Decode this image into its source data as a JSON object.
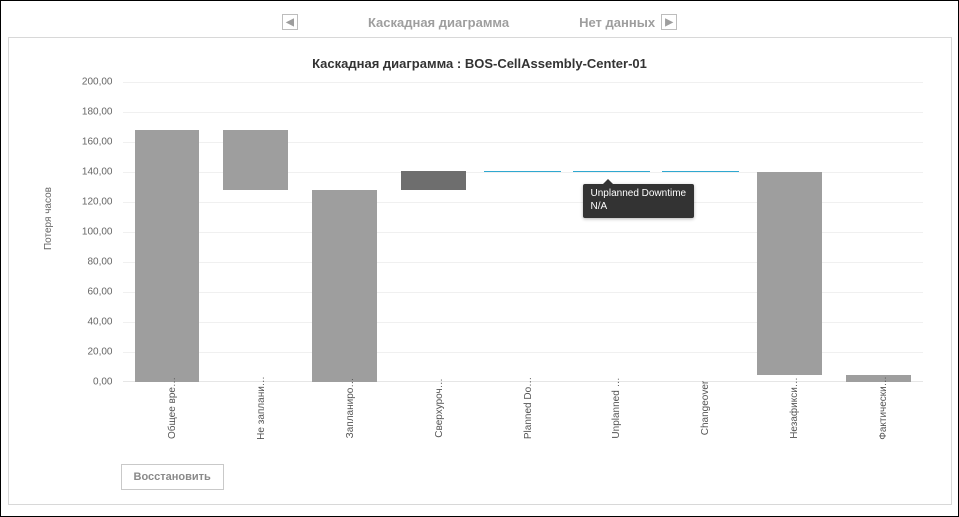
{
  "nav": {
    "center_label": "Каскадная диаграмма",
    "right_label": "Нет данных"
  },
  "chart": {
    "title": "Каскадная диаграмма : BOS-CellAssembly-Center-01",
    "ylabel": "Потеря часов",
    "reset_label": "Восстановить"
  },
  "tooltip": {
    "line1": "Unplanned Downtime",
    "line2": "N/A"
  },
  "yticks": [
    "0,00",
    "20,00",
    "40,00",
    "60,00",
    "80,00",
    "100,00",
    "120,00",
    "140,00",
    "160,00",
    "180,00",
    "200,00"
  ],
  "xcats": [
    "Общее вре…",
    "Не заплани…",
    "Запланиро…",
    "Сверхуроч…",
    "Planned Do…",
    "Unplanned …",
    "Changeover",
    "Незафикси…",
    "Фактически…"
  ],
  "chart_data": {
    "type": "bar",
    "title": "Каскадная диаграмма : BOS-CellAssembly-Center-01",
    "ylabel": "Потеря часов",
    "xlabel": "",
    "ylim": [
      0,
      200
    ],
    "categories": [
      "Общее вре…",
      "Не заплани…",
      "Запланиро…",
      "Сверхуроч…",
      "Planned Do…",
      "Unplanned …",
      "Changeover",
      "Незафикси…",
      "Фактически…"
    ],
    "bars": [
      {
        "name": "Общее вре…",
        "start": 0,
        "end": 168,
        "kind": "total"
      },
      {
        "name": "Не заплани…",
        "start": 128,
        "end": 168,
        "kind": "delta"
      },
      {
        "name": "Запланиро…",
        "start": 0,
        "end": 128,
        "kind": "total"
      },
      {
        "name": "Сверхуроч…",
        "start": 128,
        "end": 141,
        "kind": "delta_dark"
      },
      {
        "name": "Planned Do…",
        "start": 140,
        "end": 141,
        "kind": "line"
      },
      {
        "name": "Unplanned …",
        "start": 140,
        "end": 141,
        "kind": "line",
        "tooltip": "Unplanned Downtime N/A"
      },
      {
        "name": "Changeover",
        "start": 140,
        "end": 141,
        "kind": "line"
      },
      {
        "name": "Незафикси…",
        "start": 5,
        "end": 140,
        "kind": "delta"
      },
      {
        "name": "Фактически…",
        "start": 0,
        "end": 5,
        "kind": "total"
      }
    ]
  }
}
